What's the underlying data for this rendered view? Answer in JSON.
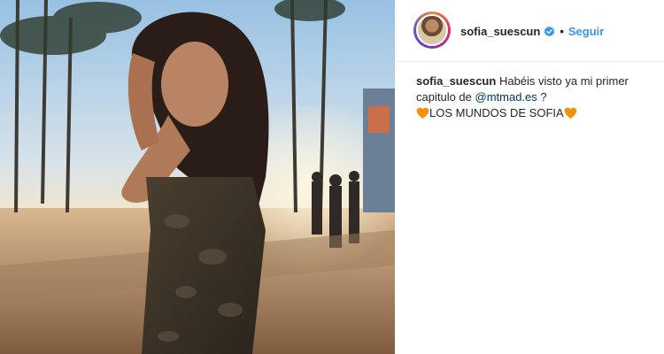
{
  "account": {
    "username": "sofia_suescun",
    "verified": true,
    "follow_label": "Seguir",
    "separator": "•"
  },
  "caption": {
    "username": "sofia_suescun",
    "text_part1": "Habéis visto ya mi primer capitulo de",
    "mention": "@mtmad.es",
    "text_part2": "?",
    "line2_text": "LOS MUNDOS DE SOFIA"
  },
  "colors": {
    "link_blue": "#3897f0",
    "mention": "#003569",
    "heart_orange": "#f4900c",
    "verified_blue": "#3897f0"
  },
  "icons": {
    "verified": "verified-badge-icon",
    "heart": "orange-heart-emoji"
  }
}
